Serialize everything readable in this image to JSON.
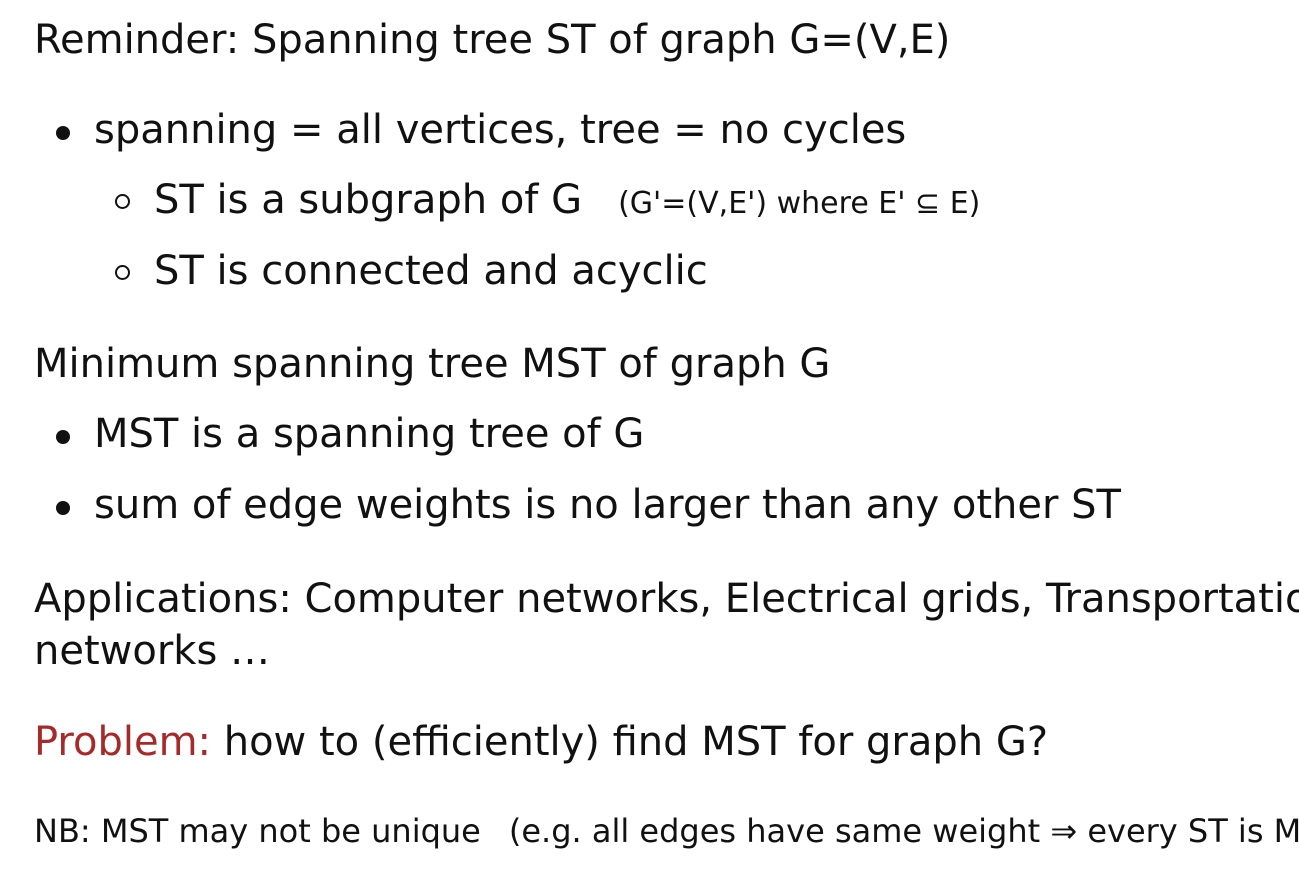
{
  "colors": {
    "text": "#111111",
    "accent": "#a52a2a",
    "background": "#ffffff"
  },
  "heading1": "Reminder: Spanning tree ST of graph G=(V,E)",
  "bullets1": {
    "item1": "spanning = all vertices, tree = no cycles",
    "sub1": "ST is a subgraph of G",
    "sub1_note": "(G'=(V,E') where E' ⊆ E)",
    "sub2": "ST is connected and acyclic"
  },
  "heading2": "Minimum spanning tree MST of graph G",
  "bullets2": {
    "item1": "MST is a spanning tree of G",
    "item2": "sum of edge weights is no larger than any other ST"
  },
  "applications": {
    "line1": "Applications: Computer networks, Electrical grids, Transportation",
    "line2": "networks …"
  },
  "problem": {
    "label": "Problem:",
    "text": "how to (efficiently) find MST for graph G?"
  },
  "note": {
    "main": "NB: MST may not be unique",
    "aside": "(e.g. all edges have same weight ⇒ every ST is MST)"
  }
}
